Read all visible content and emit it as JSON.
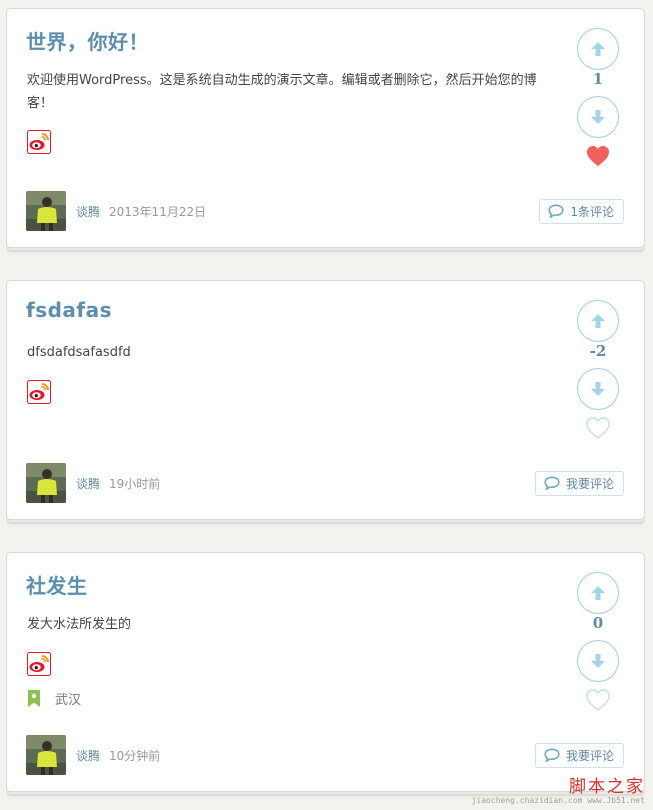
{
  "posts": [
    {
      "title": "世界，你好！",
      "excerpt": "欢迎使用WordPress。这是系统自动生成的演示文章。编辑或者删除它，然后开始您的博客！",
      "votes": "1",
      "liked": true,
      "location": "",
      "author": "谈腾",
      "time": "2013年11月22日",
      "comment_label": "1条评论"
    },
    {
      "title": "fsdafas",
      "excerpt": "dfsdafdsafasdfd",
      "votes": "-2",
      "liked": false,
      "location": "",
      "author": "谈腾",
      "time": "19小时前",
      "comment_label": "我要评论"
    },
    {
      "title": "社发生",
      "excerpt": "发大水法所发生的",
      "votes": "0",
      "liked": false,
      "location": "武汉",
      "author": "谈腾",
      "time": "10分钟前",
      "comment_label": "我要评论"
    }
  ],
  "icons": {
    "share": "weibo-icon",
    "vote_up": "arrow-up-icon",
    "vote_down": "arrow-down-icon",
    "like": "heart-icon",
    "comment": "comment-bubble-icon",
    "location": "location-pin-icon"
  },
  "colors": {
    "title": "#5a8fae",
    "vote_ring": "#9fd0e0",
    "vote_arrow": "#a5d4e3",
    "heart_active": "#f25f5c",
    "heart_inactive": "#bfe0ea",
    "location_pin": "#8cc152",
    "weibo_red": "#e6162d"
  },
  "watermark": {
    "text": "脚本之家",
    "url": "jiaocheng.chazidian.com  www.Jb51.net"
  }
}
